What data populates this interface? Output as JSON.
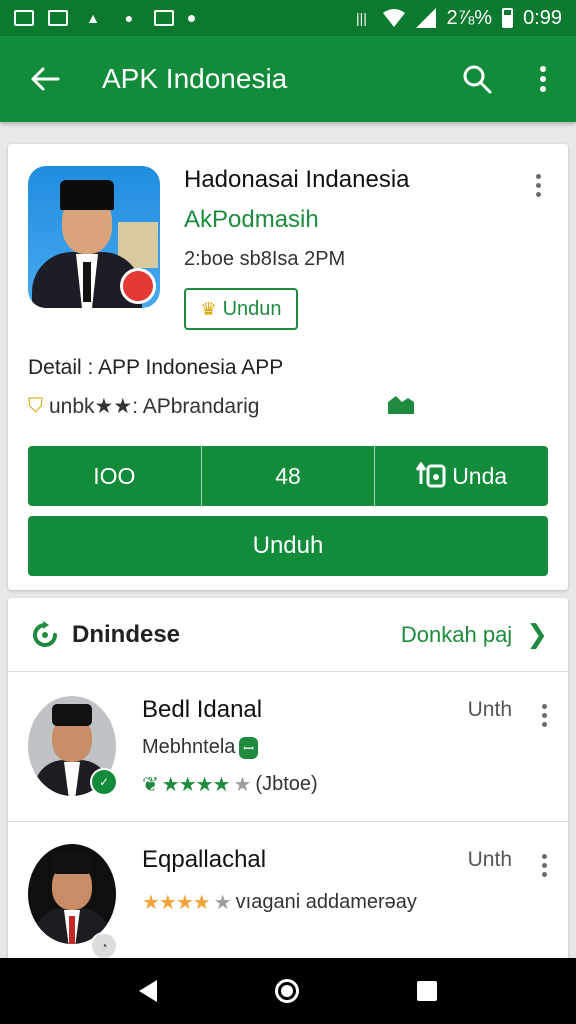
{
  "status_bar": {
    "signal_text": "2⅞%",
    "time": "0:99"
  },
  "app_bar": {
    "title": "APK Indonesia",
    "icons": [
      "back-arrow-icon",
      "search-icon",
      "more-vert-icon"
    ]
  },
  "app_card": {
    "title": "Hadonasai Indanesia",
    "developer": "AkPodmasih",
    "meta": "2:boe sb8Isa 2PM",
    "small_button_label": "Undun",
    "detail_text": "Detail : APP Indonesia APP",
    "rating_line": "unbk★★: APbrandarig",
    "stats": [
      {
        "label": "IOO"
      },
      {
        "label": "48"
      },
      {
        "label": "Unda"
      }
    ],
    "download_label": "Unduh"
  },
  "section": {
    "title": "Dnindese",
    "more_label": "Donkah paj",
    "items": [
      {
        "name": "Bedl Idanal",
        "subtitle": "Mebhntela",
        "tag": "ꟷ",
        "stars": "★★★★",
        "empty_star": "★",
        "count": "(Jbtoe)",
        "time": "Unth"
      },
      {
        "name": "Eqpallachal",
        "stars": "★★★★",
        "empty_star": "★",
        "desc": "vıagani addamerəay",
        "time": "Unth"
      }
    ]
  },
  "colors": {
    "primary": "#128c3a",
    "status": "#0b7a2f",
    "accent_text": "#1e8b3e",
    "star_orange": "#f2a33a"
  }
}
